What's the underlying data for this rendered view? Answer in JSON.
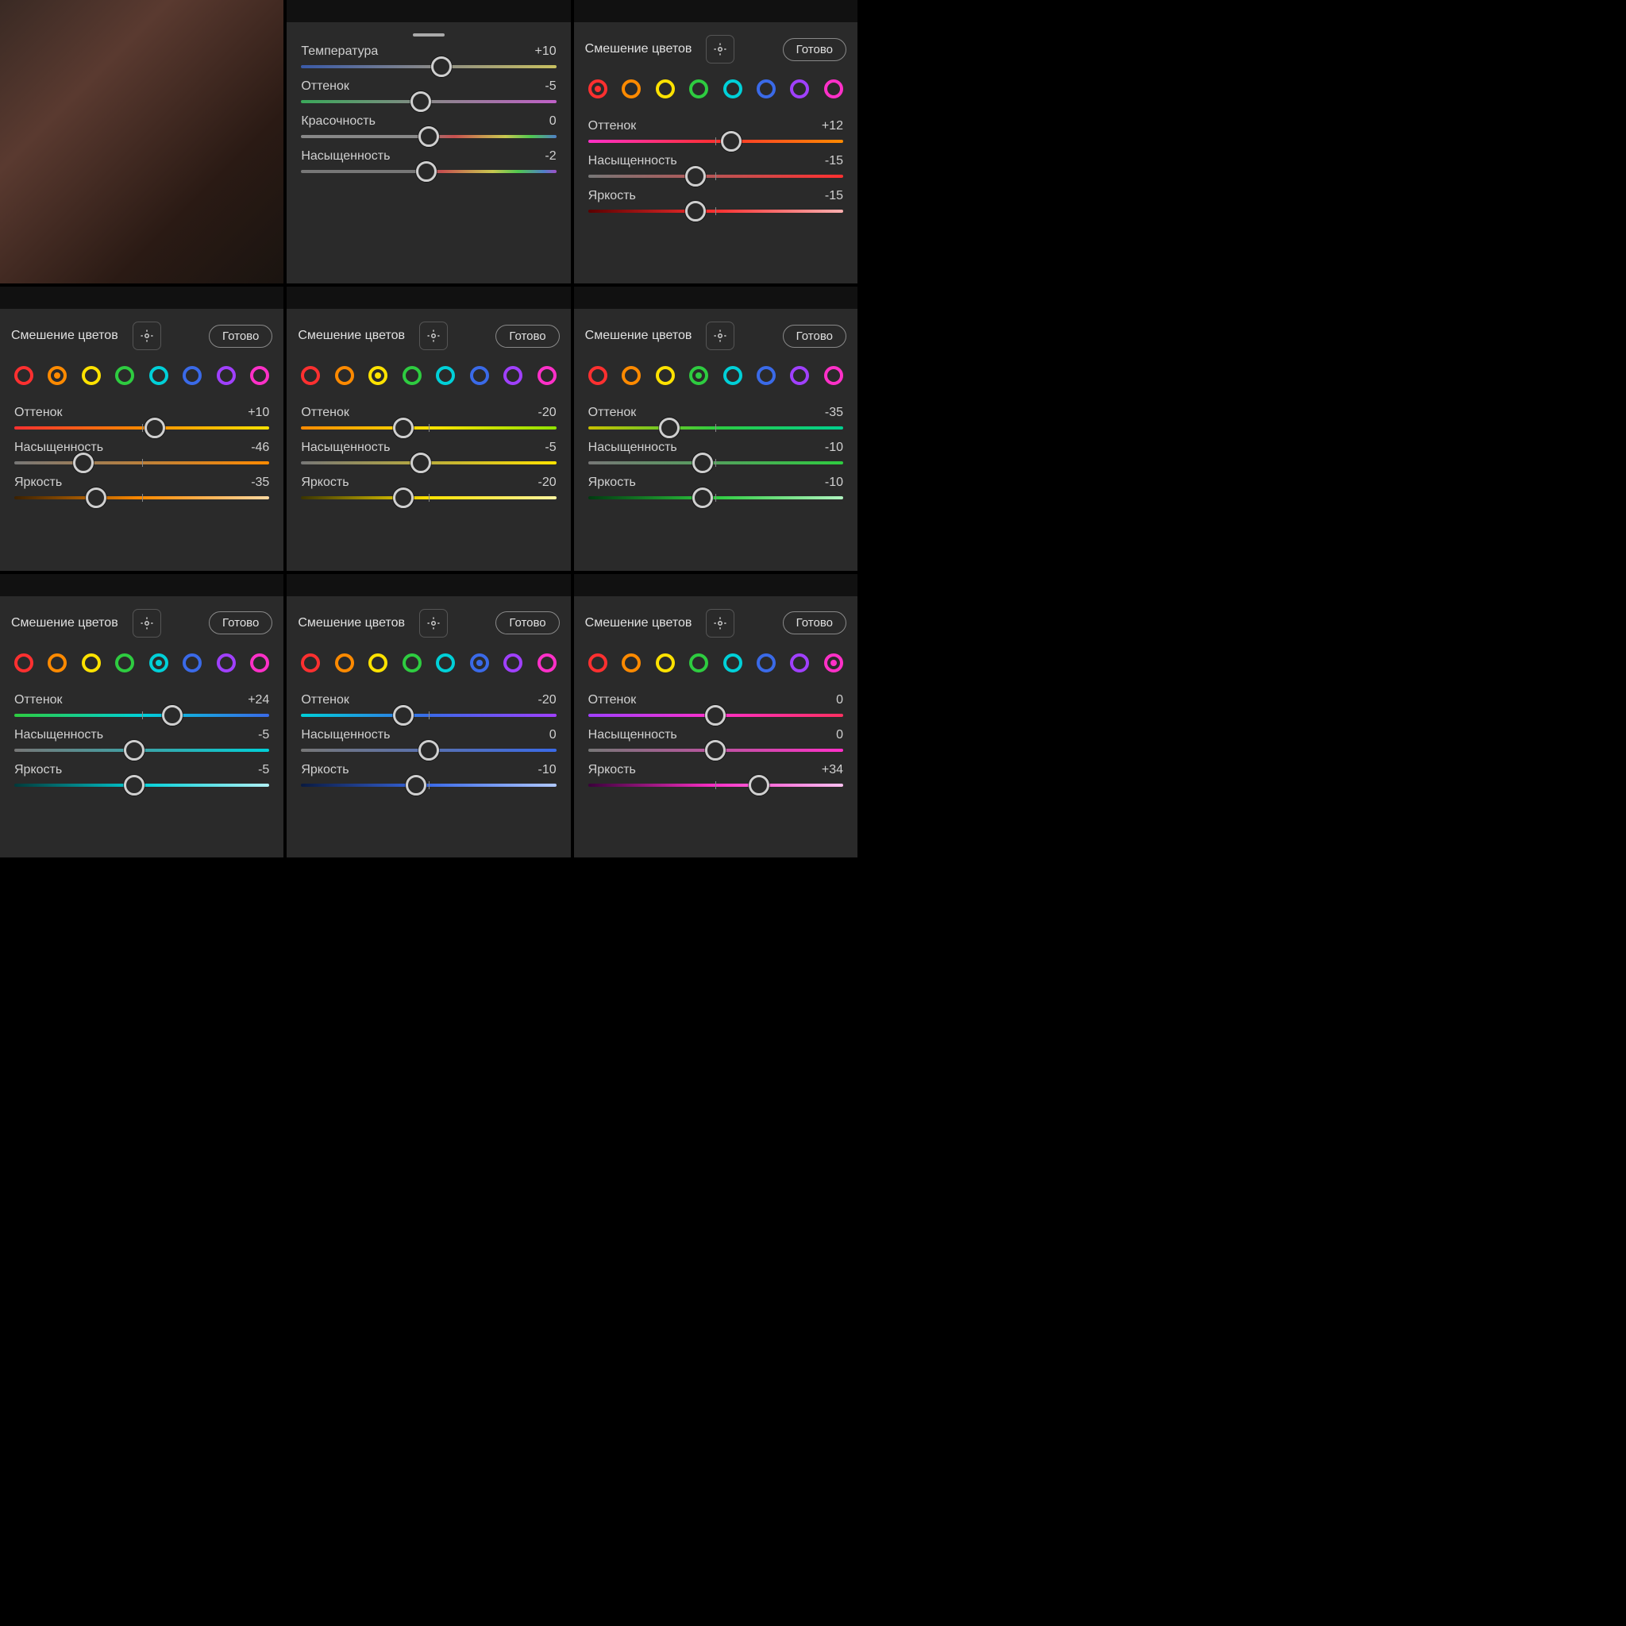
{
  "labels": {
    "colorMix": "Смешение цветов",
    "done": "Готово",
    "hue": "Оттенок",
    "sat": "Насыщенность",
    "lum": "Яркость",
    "temp": "Температура",
    "tint": "Оттенок",
    "vibrance": "Красочность"
  },
  "swatchColors": [
    "#ff3030",
    "#ff8a00",
    "#ffe200",
    "#2ecc40",
    "#00d0d8",
    "#3a6ae8",
    "#a040ff",
    "#ff30c8"
  ],
  "panels": {
    "basic": {
      "sliders": [
        {
          "key": "temp",
          "val": "+10",
          "pos": 55,
          "grad": "linear-gradient(90deg,#3a5aa8,#888,#c8c060)"
        },
        {
          "key": "tint",
          "val": "-5",
          "pos": 47,
          "grad": "linear-gradient(90deg,#3aa85a,#888,#c060c8)"
        },
        {
          "key": "vibrance",
          "val": "0",
          "pos": 50,
          "grad": "linear-gradient(90deg,#888,#888 45%,#c85050 60%,#c89050 70%,#c8c850 80%,#50c850 90%,#5080c8)"
        },
        {
          "key": "sat",
          "val": "-2",
          "pos": 49,
          "grad": "linear-gradient(90deg,#777,#777 48%,#c85050 55%,#c89050 65%,#c8c850 75%,#50c850 85%,#5080c8 95%,#a050c8)"
        }
      ]
    },
    "mix": [
      {
        "sel": 0,
        "hue": {
          "v": "+12",
          "p": 56,
          "g": "linear-gradient(90deg,#ff30c8,#ff3030,#ff8a00)"
        },
        "sat": {
          "v": "-15",
          "p": 42,
          "g": "linear-gradient(90deg,#777,#ff3030)"
        },
        "lum": {
          "v": "-15",
          "p": 42,
          "g": "linear-gradient(90deg,#5a0000,#ff3030,#ffb0b0)"
        }
      },
      {
        "sel": 1,
        "hue": {
          "v": "+10",
          "p": 55,
          "g": "linear-gradient(90deg,#ff3030,#ff8a00,#ffe200)"
        },
        "sat": {
          "v": "-46",
          "p": 27,
          "g": "linear-gradient(90deg,#777,#ff8a00)"
        },
        "lum": {
          "v": "-35",
          "p": 32,
          "g": "linear-gradient(90deg,#3a2000,#ff8a00,#ffd8a0)"
        }
      },
      {
        "sel": 2,
        "hue": {
          "v": "-20",
          "p": 40,
          "g": "linear-gradient(90deg,#ff8a00,#ffe200,#90e200)"
        },
        "sat": {
          "v": "-5",
          "p": 47,
          "g": "linear-gradient(90deg,#777,#ffe200)"
        },
        "lum": {
          "v": "-20",
          "p": 40,
          "g": "linear-gradient(90deg,#3a3400,#ffe200,#fff4a0)"
        }
      },
      {
        "sel": 3,
        "hue": {
          "v": "-35",
          "p": 32,
          "g": "linear-gradient(90deg,#c8c000,#2ecc40,#00d090)"
        },
        "sat": {
          "v": "-10",
          "p": 45,
          "g": "linear-gradient(90deg,#777,#2ecc40)"
        },
        "lum": {
          "v": "-10",
          "p": 45,
          "g": "linear-gradient(90deg,#003a10,#2ecc40,#b0f4c0)"
        }
      },
      {
        "sel": 4,
        "hue": {
          "v": "+24",
          "p": 62,
          "g": "linear-gradient(90deg,#2ecc40,#00d0d8,#3a6ae8)"
        },
        "sat": {
          "v": "-5",
          "p": 47,
          "g": "linear-gradient(90deg,#777,#00d0d8)"
        },
        "lum": {
          "v": "-5",
          "p": 47,
          "g": "linear-gradient(90deg,#003a3a,#00d0d8,#b0f0f4)"
        }
      },
      {
        "sel": 5,
        "hue": {
          "v": "-20",
          "p": 40,
          "g": "linear-gradient(90deg,#00d0d8,#3a6ae8,#a040ff)"
        },
        "sat": {
          "v": "0",
          "p": 50,
          "g": "linear-gradient(90deg,#777,#3a6ae8)"
        },
        "lum": {
          "v": "-10",
          "p": 45,
          "g": "linear-gradient(90deg,#0a1a40,#3a6ae8,#b0c8ff)"
        }
      },
      {
        "sel": 7,
        "hue": {
          "v": "0",
          "p": 50,
          "g": "linear-gradient(90deg,#a040ff,#ff30c8,#ff3060)"
        },
        "sat": {
          "v": "0",
          "p": 50,
          "g": "linear-gradient(90deg,#777,#ff30c8)"
        },
        "lum": {
          "v": "+34",
          "p": 67,
          "g": "linear-gradient(90deg,#3a003a,#ff30c8,#ffc0f0)"
        }
      }
    ]
  }
}
